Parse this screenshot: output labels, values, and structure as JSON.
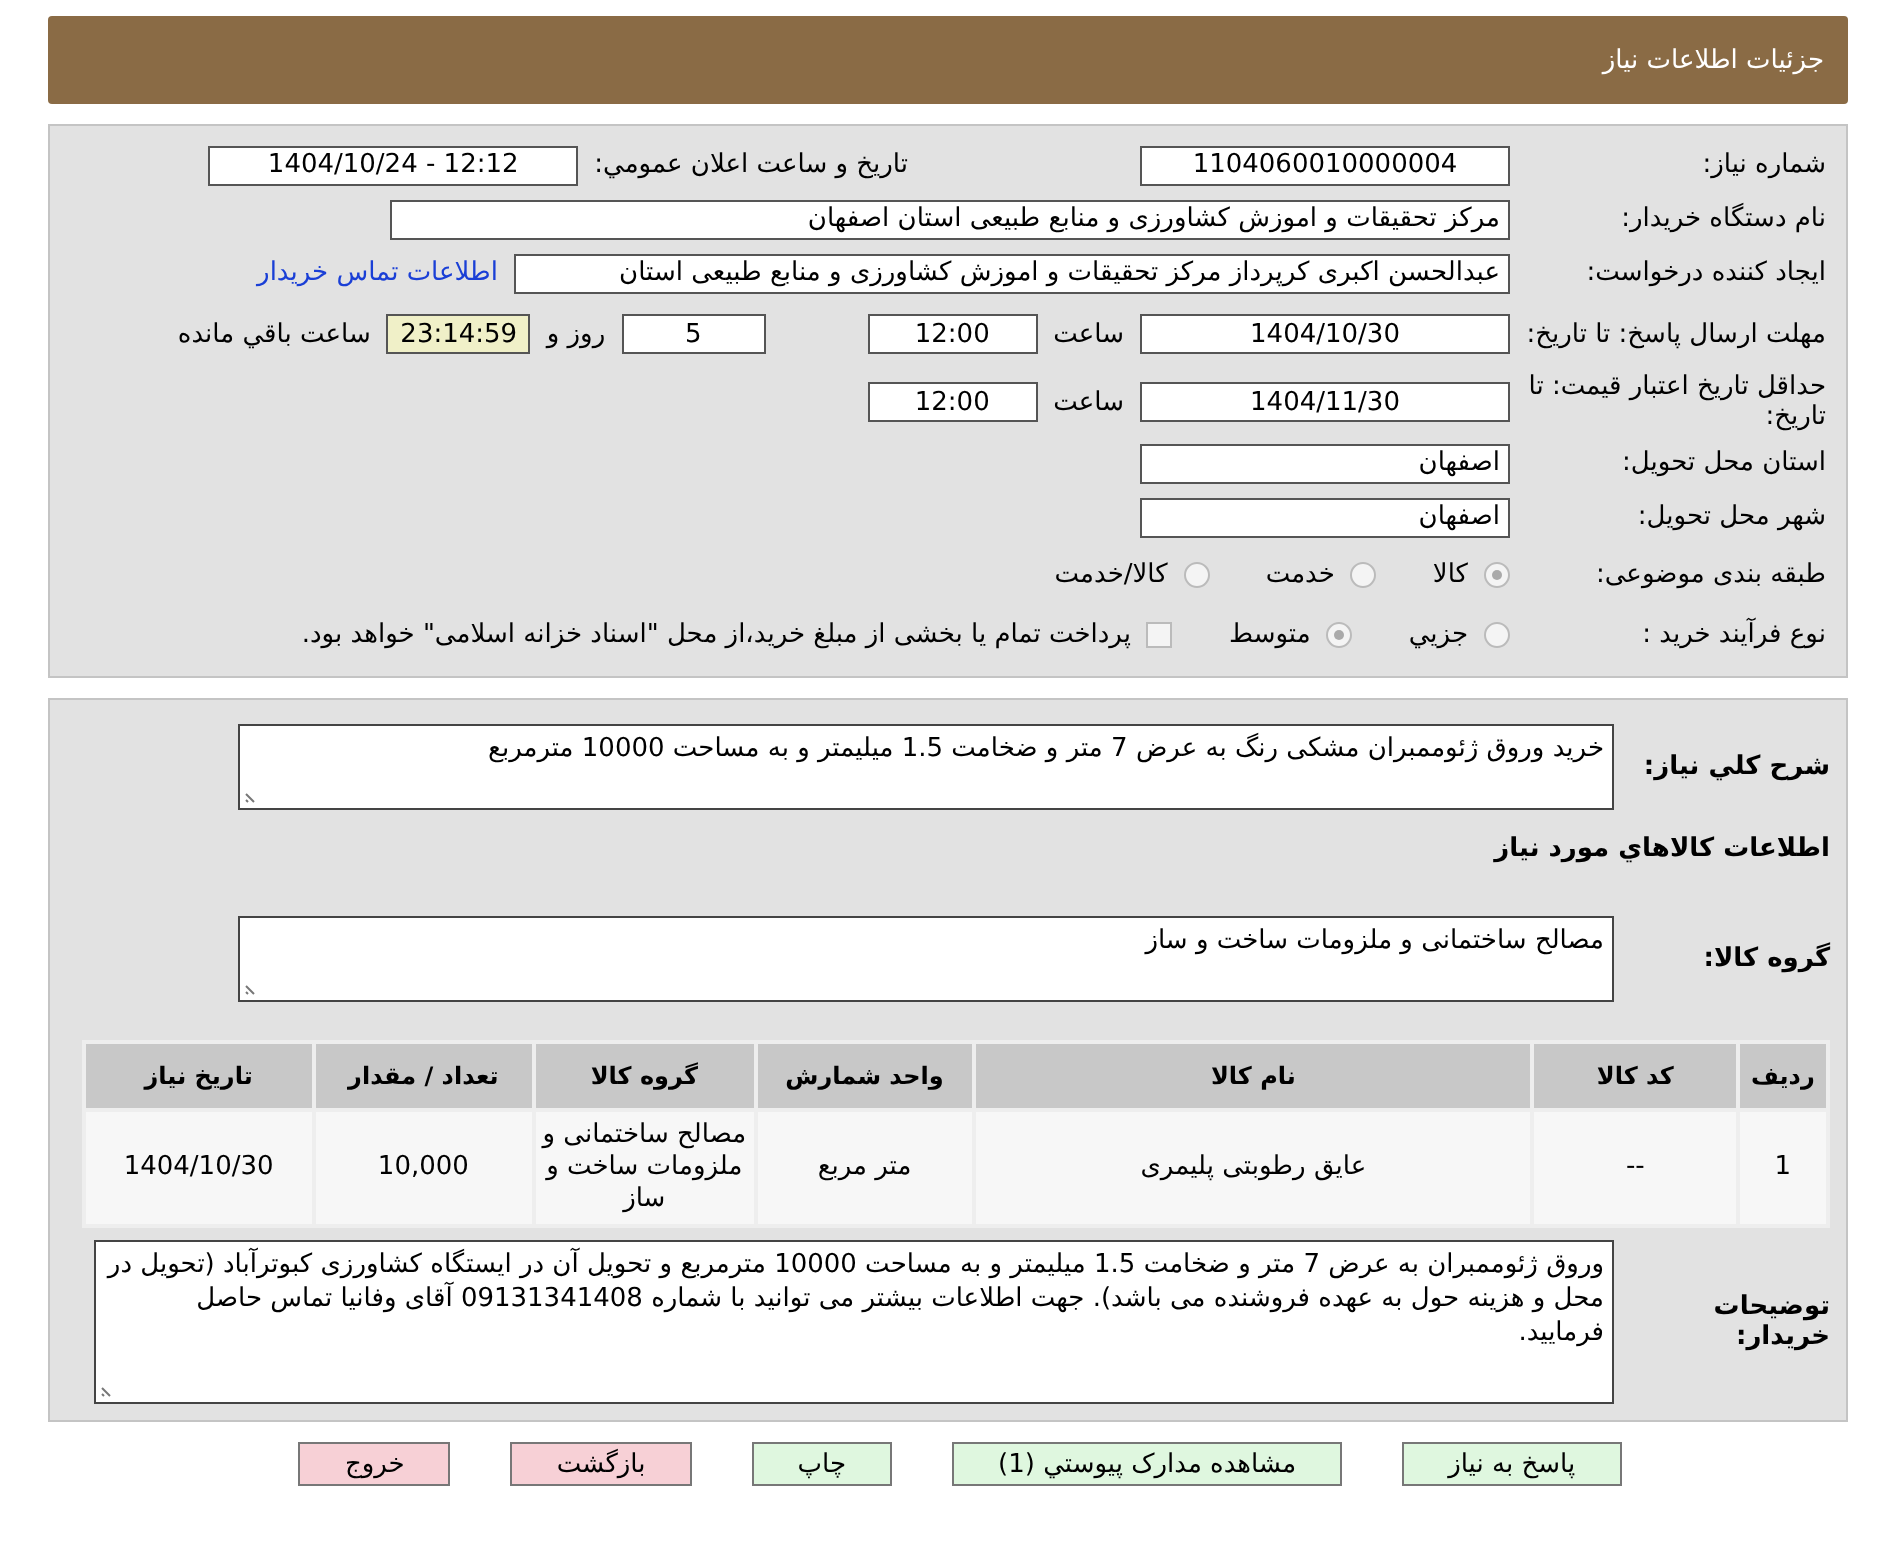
{
  "header": {
    "title": "جزئیات اطلاعات نیاز"
  },
  "need_number": {
    "label": "شماره نیاز:",
    "value": "1104060010000004"
  },
  "announce": {
    "label": "تاريخ و ساعت اعلان عمومي:",
    "value": "1404/10/24 - 12:12"
  },
  "buyer_org": {
    "label": "نام دستگاه خریدار:",
    "value": "مرکز تحقیقات و اموزش کشاورزی و منابع طبیعی استان اصفهان"
  },
  "requester": {
    "label": "ایجاد کننده درخواست:",
    "value": "عبدالحسن اکبری کرپرداز مرکز تحقیقات و اموزش کشاورزی و منابع طبیعی استان",
    "link": "اطلاعات تماس خریدار"
  },
  "deadline": {
    "label": "مهلت ارسال پاسخ: تا تاریخ:",
    "date": "1404/10/30",
    "time_label": "ساعت",
    "time": "12:00",
    "days": "5",
    "days_label": "روز و",
    "remaining": "23:14:59",
    "remaining_label": "ساعت باقي مانده"
  },
  "validity": {
    "label": "حداقل تاریخ اعتبار قیمت: تا تاریخ:",
    "date": "1404/11/30",
    "time_label": "ساعت",
    "time": "12:00"
  },
  "province": {
    "label": "استان محل تحویل:",
    "value": "اصفهان"
  },
  "city": {
    "label": "شهر محل تحویل:",
    "value": "اصفهان"
  },
  "category": {
    "label": "طبقه بندی موضوعی:",
    "options": [
      {
        "label": "کالا",
        "selected": true
      },
      {
        "label": "خدمت",
        "selected": false
      },
      {
        "label": "کالا/خدمت",
        "selected": false
      }
    ]
  },
  "purchase_type": {
    "label": "نوع فرآیند خرید :",
    "options": [
      {
        "label": "جزيي",
        "selected": false
      },
      {
        "label": "متوسط",
        "selected": true
      }
    ],
    "payment_note": {
      "checked": false,
      "text": "پرداخت تمام یا بخشی از مبلغ خرید،از محل \"اسناد خزانه اسلامی\" خواهد بود."
    }
  },
  "description": {
    "label": "شرح کلي نياز:",
    "value": "خرید وروق ژئوممبران مشکی رنگ به عرض 7 متر و ضخامت 1.5 میلیمتر و به مساحت 10000 مترمربع"
  },
  "goods_heading": "اطلاعات کالاهاي مورد نياز",
  "goods_group": {
    "label": "گروه کالا:",
    "value": "مصالح ساختمانی و ملزومات ساخت و ساز"
  },
  "table": {
    "columns": [
      "ردیف",
      "کد کالا",
      "نام کالا",
      "واحد شمارش",
      "گروه کالا",
      "تعداد / مقدار",
      "تاریخ نیاز"
    ],
    "rows": [
      [
        "1",
        "--",
        "عایق رطوبتی پلیمری",
        "متر مربع",
        "مصالح ساختمانی و ملزومات ساخت و ساز",
        "10,000",
        "1404/10/30"
      ]
    ]
  },
  "buyer_notes": {
    "label": "توضیحات خریدار:",
    "value": "وروق ژئوممبران به عرض 7 متر و ضخامت 1.5 میلیمتر و به مساحت 10000 مترمربع و تحویل آن در ایستگاه  کشاورزی کبوترآباد (تحویل در محل و هزینه حول  به عهده فروشنده می باشد). جهت اطلاعات بیشتر می توانید با شماره 09131341408 آقای وفانیا تماس حاصل فرمایید."
  },
  "buttons": [
    {
      "label": "پاسخ به نیاز",
      "kind": "action"
    },
    {
      "label": "مشاهده مدارک پیوستي (1)",
      "kind": "action"
    },
    {
      "label": "چاپ",
      "kind": "action"
    },
    {
      "label": "بازگشت",
      "kind": "exit"
    },
    {
      "label": "خروج",
      "kind": "exit"
    }
  ]
}
